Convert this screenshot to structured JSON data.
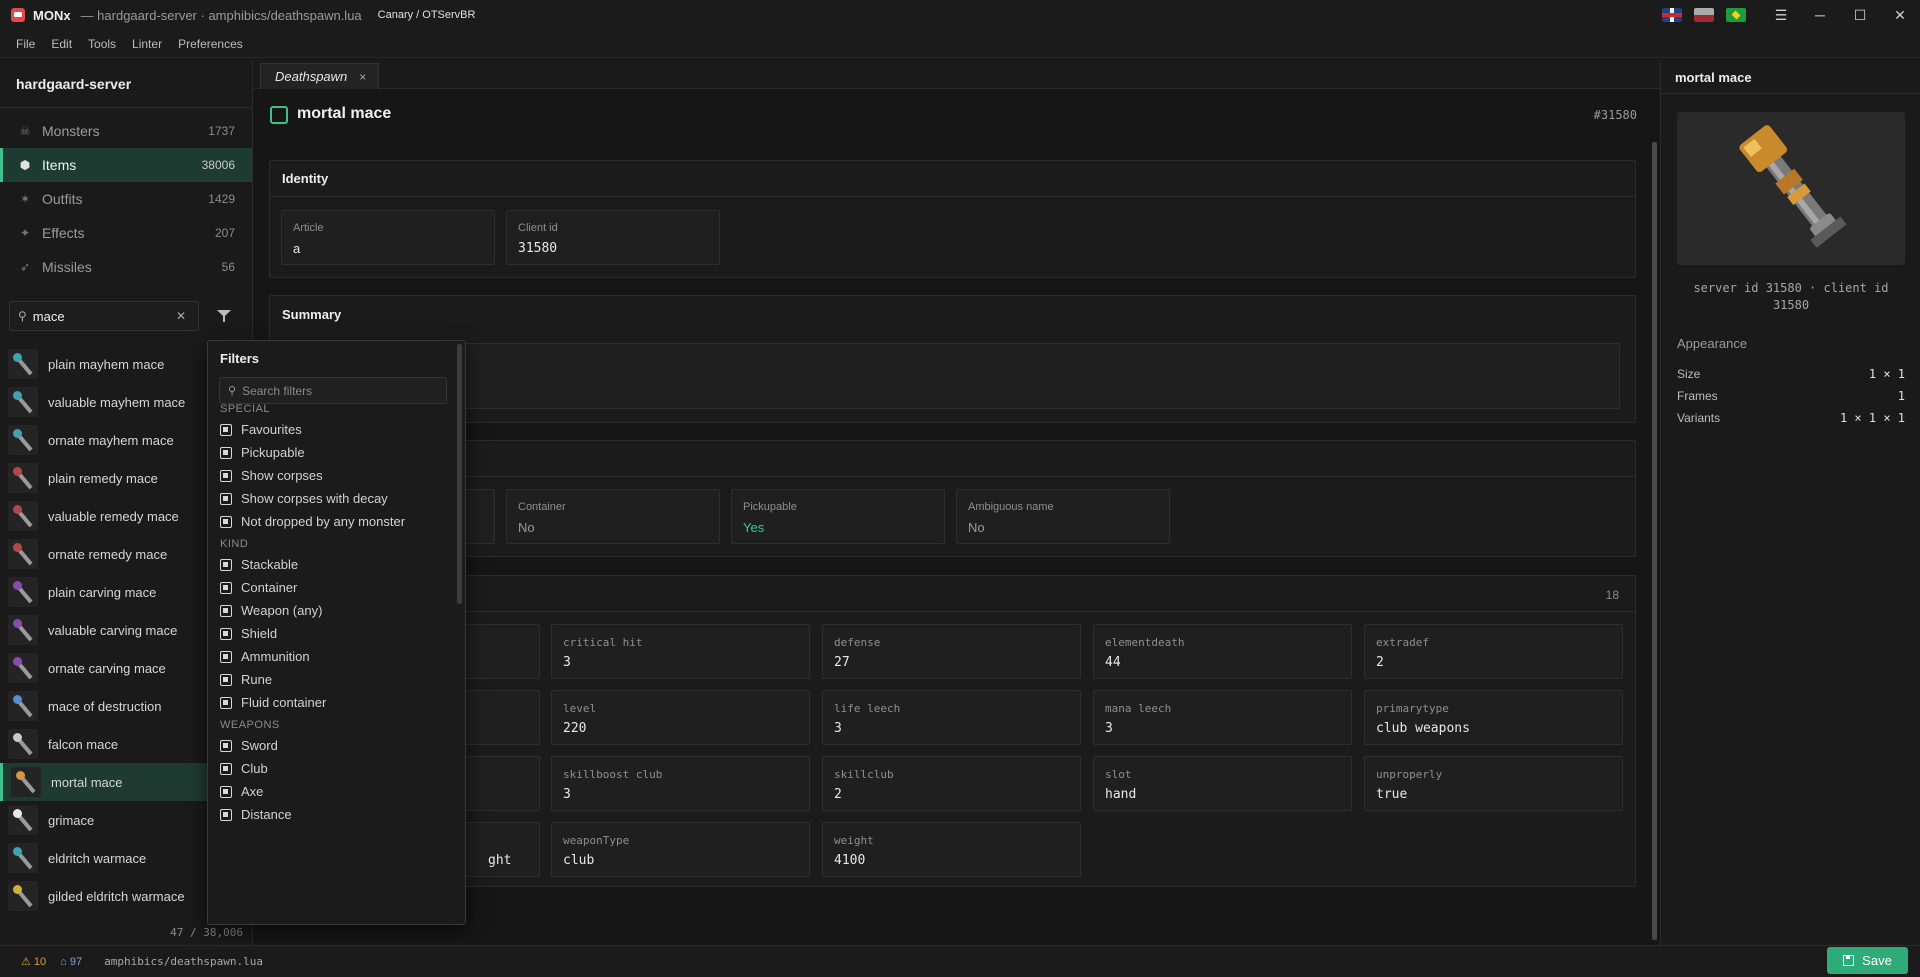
{
  "titlebar": {
    "app_name": "MONx",
    "window_title": "— hardgaard-server · amphibics/deathspawn.lua",
    "server": "Canary / OTServBR",
    "flags": [
      "uk-flag-icon",
      "pl-flag-icon",
      "br-flag-icon"
    ],
    "hamburger": "☰",
    "minimize": "─",
    "maximize": "☐",
    "close": "✕"
  },
  "menu": [
    "File",
    "Edit",
    "Tools",
    "Linter",
    "Preferences"
  ],
  "sidebar": {
    "project": "hardgaard-server",
    "categories": [
      {
        "label": "Monsters",
        "count": "1737",
        "icon": "skull-icon"
      },
      {
        "label": "Items",
        "count": "38006",
        "icon": "cube-icon"
      },
      {
        "label": "Outfits",
        "count": "1429",
        "icon": "person-icon"
      },
      {
        "label": "Effects",
        "count": "207",
        "icon": "sparkle-icon"
      },
      {
        "label": "Missiles",
        "count": "56",
        "icon": "arrow-icon"
      }
    ],
    "search_value": "mace",
    "results": [
      "plain mayhem mace",
      "valuable mayhem mace",
      "ornate mayhem mace",
      "plain remedy mace",
      "valuable remedy mace",
      "ornate remedy mace",
      "plain carving mace",
      "valuable carving mace",
      "ornate carving mace",
      "mace of destruction",
      "falcon mace",
      "mortal mace",
      "grimace",
      "eldritch warmace",
      "gilded eldritch warmace"
    ],
    "selected_result": "mortal mace",
    "count": "47 / 38,006"
  },
  "tab": {
    "label": "Deathspawn",
    "close": "×"
  },
  "item": {
    "title": "mortal mace",
    "id": "#31580",
    "identity": {
      "header": "Identity",
      "fields": [
        {
          "label": "Article",
          "value": "a"
        },
        {
          "label": "Client id",
          "value": "31580"
        }
      ]
    },
    "summary": {
      "header": "Summary"
    },
    "flags_section": {
      "fields": [
        {
          "label": "Container",
          "value": "No"
        },
        {
          "label": "Pickupable",
          "value": "Yes"
        },
        {
          "label": "Ambiguous name",
          "value": "No"
        }
      ]
    },
    "attributes": {
      "count": "18",
      "rows": [
        [
          {
            "label": "critical hit",
            "value": "3"
          },
          {
            "label": "defense",
            "value": "27"
          },
          {
            "label": "elementdeath",
            "value": "44"
          },
          {
            "label": "extradef",
            "value": "2"
          }
        ],
        [
          {
            "label": "level",
            "value": "220"
          },
          {
            "label": "life leech",
            "value": "3"
          },
          {
            "label": "mana leech",
            "value": "3"
          },
          {
            "label": "primarytype",
            "value": "club weapons"
          }
        ],
        [
          {
            "label": "skillboost club",
            "value": "3"
          },
          {
            "label": "skillclub",
            "value": "2"
          },
          {
            "label": "slot",
            "value": "hand"
          },
          {
            "label": "unproperly",
            "value": "true"
          }
        ],
        [
          {
            "label": "weaponType",
            "value": "club"
          },
          {
            "label": "weight",
            "value": "4100"
          }
        ]
      ],
      "partial_value": "ght"
    }
  },
  "filters": {
    "title": "Filters",
    "search_placeholder": "Search filters",
    "sections": [
      {
        "name": "SPECIAL",
        "options": [
          "Favourites",
          "Pickupable",
          "Show corpses",
          "Show corpses with decay",
          "Not dropped by any monster"
        ]
      },
      {
        "name": "KIND",
        "options": [
          "Stackable",
          "Container",
          "Weapon (any)",
          "Shield",
          "Ammunition",
          "Rune",
          "Fluid container"
        ]
      },
      {
        "name": "WEAPONS",
        "options": [
          "Sword",
          "Club",
          "Axe",
          "Distance"
        ]
      }
    ]
  },
  "inspector": {
    "title": "mortal mace",
    "ids_text": "server id 31580 · client id 31580",
    "appearance_header": "Appearance",
    "props": [
      {
        "label": "Size",
        "value": "1 × 1"
      },
      {
        "label": "Frames",
        "value": "1"
      },
      {
        "label": "Variants",
        "value": "1 × 1 × 1"
      }
    ]
  },
  "status": {
    "warnings": "⚠ 10",
    "infos": "⌂ 97",
    "path": "amphibics/deathspawn.lua",
    "save_label": "Save"
  },
  "colors": {
    "accent": "#3fbf8a",
    "selected_bg": "#1f3b31",
    "yes_value": "#3fc78d"
  }
}
